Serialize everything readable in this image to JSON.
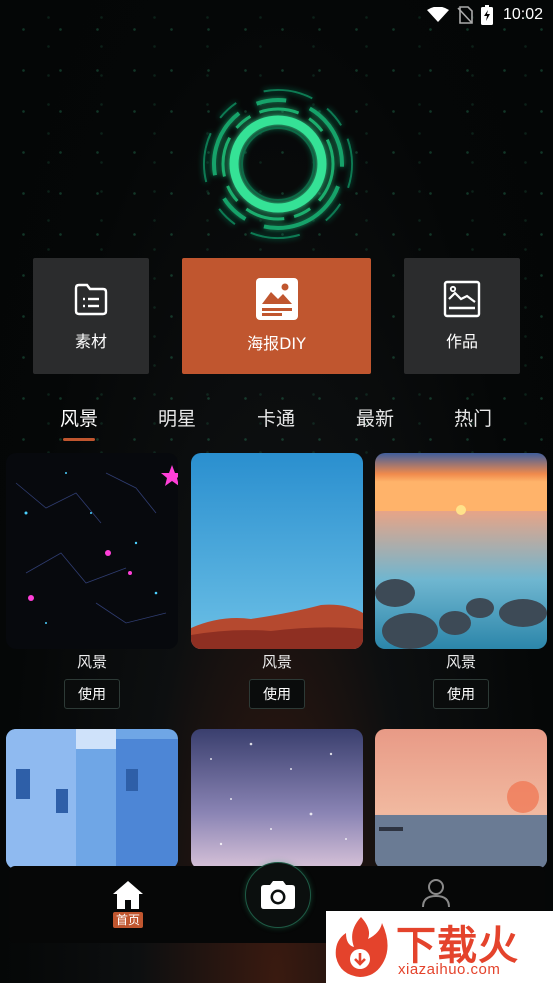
{
  "status": {
    "time": "10:02"
  },
  "tiles": [
    {
      "label": "素材",
      "icon": "folder-list-icon"
    },
    {
      "label": "海报DIY",
      "icon": "poster-image-icon",
      "accent": "#c0562f"
    },
    {
      "label": "作品",
      "icon": "picture-frame-icon"
    }
  ],
  "tabs": [
    "风景",
    "明星",
    "卡通",
    "最新",
    "热门"
  ],
  "active_tab": "风景",
  "cards": [
    {
      "title": "风景",
      "button": "使用",
      "image": "starry-constellation-night-sky"
    },
    {
      "title": "风景",
      "button": "使用",
      "image": "blue-sky-over-red-desert-hill"
    },
    {
      "title": "风景",
      "button": "使用",
      "image": "sunset-over-sea-with-rocks"
    },
    {
      "image": "blue-painted-alley-houses"
    },
    {
      "image": "purple-twilight-star-sky"
    },
    {
      "image": "pink-sunset-over-sea"
    }
  ],
  "nav": {
    "home_label": "首页",
    "me_label": "我的"
  },
  "watermark": {
    "name": "下载火",
    "url": "xiazaihuo.com"
  },
  "colors": {
    "accent": "#c0562f",
    "ring": "#2fd08a",
    "tile_bg": "#2b2c2d"
  }
}
